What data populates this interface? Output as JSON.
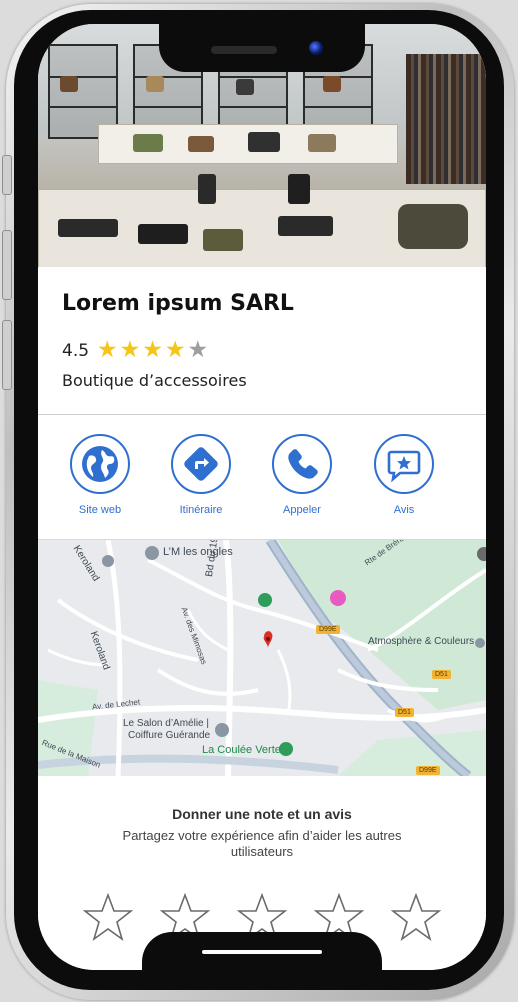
{
  "business": {
    "name": "Lorem ipsum SARL",
    "rating": "4.5",
    "stars": [
      {
        "icon": "star-filled-icon",
        "filled": true
      },
      {
        "icon": "star-filled-icon",
        "filled": true
      },
      {
        "icon": "star-filled-icon",
        "filled": true
      },
      {
        "icon": "star-filled-icon",
        "filled": true
      },
      {
        "icon": "star-empty-icon",
        "filled": false
      }
    ],
    "category": "Boutique d’accessoires"
  },
  "actions": [
    {
      "label": "Site web",
      "icon": "globe-icon"
    },
    {
      "label": "Itinéraire",
      "icon": "directions-icon"
    },
    {
      "label": "Appeler",
      "icon": "phone-icon"
    },
    {
      "label": "Avis",
      "icon": "review-star-icon"
    }
  ],
  "map": {
    "labels": {
      "keroland_top": "Keroland",
      "keroland_mid": "Keroland",
      "ongles": "L’M les ongles",
      "bd_19_mars": "Bd du 19 Mars 19",
      "av_mimosas": "Av. des Mimosas",
      "rte_brehadour": "Rte de Bréhadour",
      "atmosphere": "Atmosphère & Couleurs",
      "av_lechet": "Av. de Lechet",
      "salon_1": "Le Salon d’Amélie |",
      "salon_2": "Coiffure Guérande",
      "coulee": "La Coulée Verte",
      "rue_maison": "Rue de la Maison"
    },
    "road_numbers": {
      "d99e_1": "D99E",
      "d51_1": "D51",
      "d51_2": "D51",
      "d99e_2": "D99E"
    },
    "colors": {
      "primary_road": "#8fa8c8",
      "pin_red": "#d93025",
      "poi_green": "#2e9d5a",
      "poi_pink": "#e85bc2"
    }
  },
  "review": {
    "title": "Donner une note et un avis",
    "description": "Partagez votre expérience afin d’aider les autres utilisateurs",
    "empty_stars": 5
  },
  "colors": {
    "accent": "#2f6fd0",
    "star_gold": "#f5c518"
  }
}
